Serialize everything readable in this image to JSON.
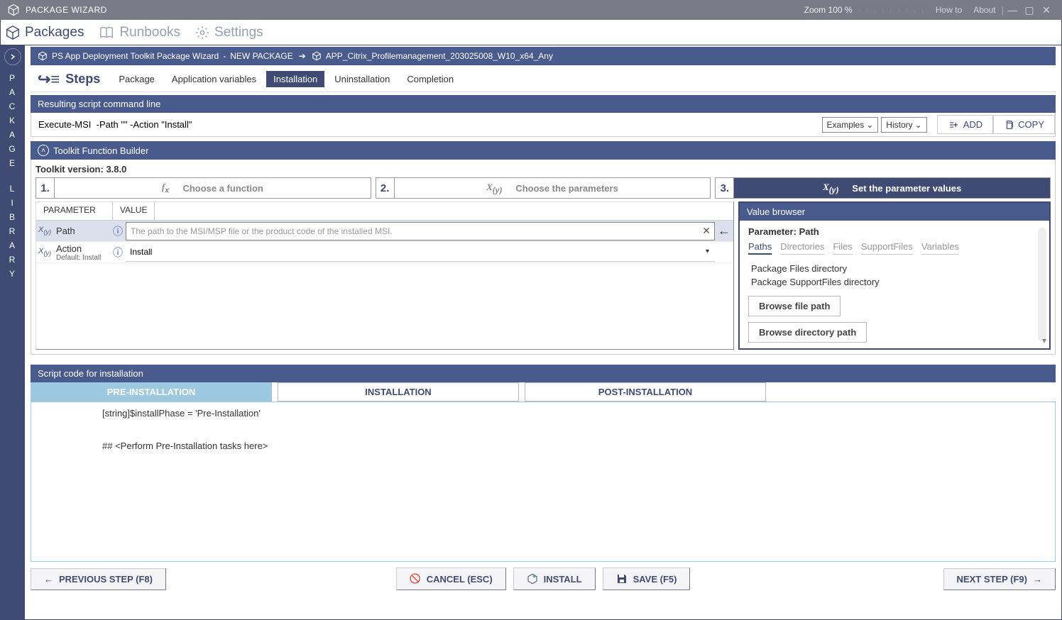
{
  "titlebar": {
    "title": "PACKAGE WIZARD",
    "zoom_label": "Zoom",
    "zoom_value": "100 %",
    "howto": "How to",
    "about": "About"
  },
  "topnav": {
    "packages": "Packages",
    "runbooks": "Runbooks",
    "settings": "Settings"
  },
  "side_rail": "PACKAGE LIBRARY",
  "breadcrumb": {
    "text1": "PS App Deployment Toolkit Package Wizard",
    "text2": "NEW PACKAGE",
    "pkg_name": "APP_Citrix_Profilemanagement_203025008_W10_x64_Any"
  },
  "steps": {
    "label": "Steps",
    "tabs": [
      "Package",
      "Application variables",
      "Installation",
      "Uninstallation",
      "Completion"
    ],
    "active_index": 2
  },
  "cmd_panel": {
    "header": "Resulting script command line",
    "value": "Execute-MSI  -Path \"\" -Action \"Install\"",
    "examples": "Examples",
    "history": "History",
    "add": "ADD",
    "copy": "COPY"
  },
  "builder": {
    "header": "Toolkit Function Builder",
    "toolkit_label": "Toolkit version:",
    "toolkit_version": "3.8.0",
    "step1": "Choose a function",
    "step2": "Choose the parameters",
    "step3": "Set the parameter values"
  },
  "param_table": {
    "col_parameter": "PARAMETER",
    "col_value": "VALUE",
    "rows": [
      {
        "name": "Path",
        "default": "",
        "placeholder": "The path to the MSI/MSP file or the product code of the installed MSI.",
        "value": ""
      },
      {
        "name": "Action",
        "default": "Default: Install",
        "placeholder": "",
        "value": "Install"
      }
    ]
  },
  "value_browser": {
    "header": "Value browser",
    "param_label": "Parameter:",
    "param_name": "Path",
    "tabs": [
      "Paths",
      "Directories",
      "Files",
      "SupportFiles",
      "Variables"
    ],
    "active_tab": 0,
    "items": [
      "Package Files directory",
      "Package SupportFiles directory"
    ],
    "browse_file": "Browse file path",
    "browse_dir": "Browse directory path"
  },
  "script": {
    "header": "Script code for installation",
    "tabs": [
      "PRE-INSTALLATION",
      "INSTALLATION",
      "POST-INSTALLATION"
    ],
    "active_tab": 0,
    "lines": [
      "[string]$installPhase = 'Pre-Installation'",
      "",
      "## <Perform Pre-Installation tasks here>"
    ]
  },
  "footer": {
    "prev": "PREVIOUS STEP (F8)",
    "cancel": "CANCEL (ESC)",
    "install": "INSTALL",
    "save": "SAVE (F5)",
    "next": "NEXT STEP (F9)"
  }
}
